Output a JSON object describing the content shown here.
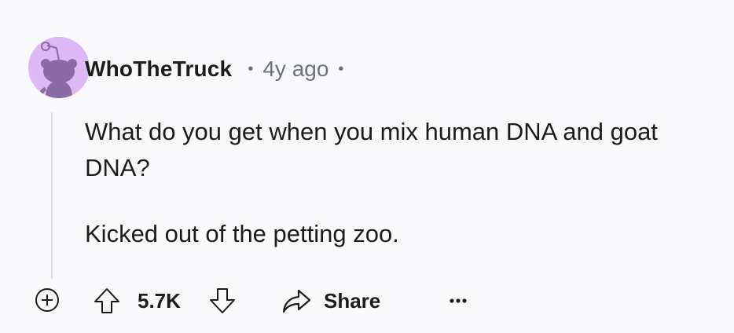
{
  "comment": {
    "username": "WhoTheTruck",
    "separator": "•",
    "timestamp": "4y ago",
    "avatar_color": "#dcb8f5",
    "body_paragraphs": [
      "What do you get when you mix human DNA and goat DNA?",
      "Kicked out of the petting zoo."
    ]
  },
  "actions": {
    "expand_icon": "plus-circle-icon",
    "upvote_icon": "arrow-up-outline-icon",
    "score": "5.7K",
    "downvote_icon": "arrow-down-outline-icon",
    "share_icon": "share-arrow-icon",
    "share_label": "Share",
    "more_icon": "ellipsis-icon"
  }
}
